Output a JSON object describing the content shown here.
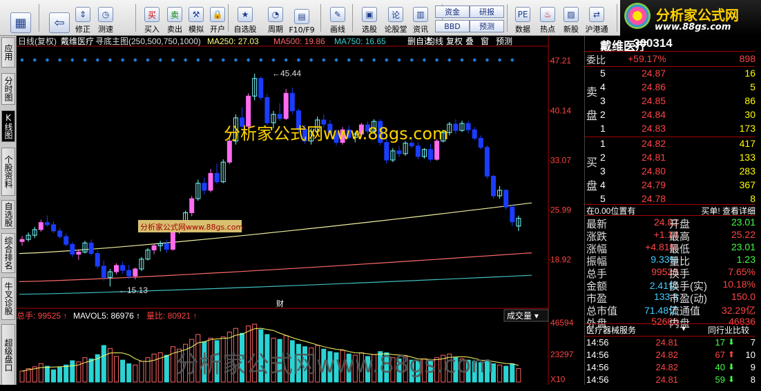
{
  "toolbar": {
    "buttons": [
      {
        "label": "",
        "icon": "grid-icon"
      },
      {
        "label": "",
        "icon": "back-arrow-icon"
      },
      {
        "label": "修正",
        "icon": "up-down-icon"
      },
      {
        "label": "测速",
        "icon": "clock-icon"
      },
      {
        "label": "买入",
        "icon": "buy-icon"
      },
      {
        "label": "卖出",
        "icon": "sell-icon"
      },
      {
        "label": "模拟",
        "icon": "hammer-icon"
      },
      {
        "label": "开户",
        "icon": "lock-icon"
      },
      {
        "label": "自选股",
        "icon": "star-icon"
      },
      {
        "label": "周期",
        "icon": "cycle-icon"
      },
      {
        "label": "F10/F9",
        "icon": "f10-icon"
      },
      {
        "label": "画线",
        "icon": "pen-icon"
      },
      {
        "label": "选股",
        "icon": "select-icon"
      },
      {
        "label": "论股堂",
        "icon": "forum-icon"
      },
      {
        "label": "资讯",
        "icon": "news-icon"
      },
      {
        "label": "数据",
        "icon": "pe-icon"
      },
      {
        "label": "热点",
        "icon": "fire-icon"
      },
      {
        "label": "新股",
        "icon": "new-icon"
      },
      {
        "label": "沪港通",
        "icon": "hk-icon"
      }
    ],
    "small": {
      "zijin": "资金",
      "bbd": "BBD",
      "yanbao": "研报",
      "yuce": "预测"
    },
    "buy_text": "买",
    "sell_text": "卖",
    "lun_text": "论"
  },
  "logo": {
    "title": "分析家公式网",
    "url": "www.88gs.com"
  },
  "sidetabs": [
    "应用",
    "分时图",
    "K线图",
    "个股资料",
    "自选股",
    "综合排名",
    "牛叉诊股",
    "超级盘口"
  ],
  "chart": {
    "period": "日线(复权)",
    "name": "戴维医疗",
    "indicator": "寻底主图(250,500,750,1000)",
    "ma250": "MA250: 27.03",
    "ma500": "MA500: 19.86",
    "ma750": "MA750: 16.65",
    "tools": [
      "删自选",
      "均线",
      "复权",
      "叠",
      "窗",
      "预测"
    ],
    "price_ticks": [
      "47.21",
      "40.14",
      "33.07",
      "25.99",
      "18.92"
    ],
    "max_label": "45.44",
    "min_label": "15.13",
    "watermark": "分析家公式网www.88gs.com",
    "badge": "分析家公式网www.88gs.com",
    "cai": "财",
    "vol_ticks": [
      "46594",
      "23297",
      "X10"
    ],
    "vol_header": {
      "zongshou": "总手: 99525",
      "mavol5": "MAVOL5: 86976",
      "liangbi": "量比: 80921"
    },
    "vol_dropdown": "成交量",
    "vol_watermark": "分析家公式网www.88gs.com"
  },
  "chart_data": {
    "type": "candlestick",
    "ylim": [
      12.5,
      49.0
    ],
    "candles": [
      [
        21.5,
        22.3,
        20.9,
        21.8
      ],
      [
        21.8,
        22.8,
        21.5,
        22.4
      ],
      [
        22.4,
        23.6,
        22.0,
        23.2
      ],
      [
        23.2,
        24.6,
        22.9,
        24.2
      ],
      [
        24.2,
        25.2,
        23.6,
        23.9
      ],
      [
        23.9,
        24.4,
        22.7,
        23.0
      ],
      [
        23.0,
        23.4,
        21.9,
        22.2
      ],
      [
        22.2,
        22.6,
        20.8,
        21.1
      ],
      [
        21.1,
        21.4,
        19.3,
        19.7
      ],
      [
        19.7,
        20.4,
        18.9,
        20.0
      ],
      [
        20.0,
        21.6,
        19.8,
        21.3
      ],
      [
        21.3,
        21.8,
        19.5,
        19.8
      ],
      [
        19.8,
        20.2,
        17.6,
        18.0
      ],
      [
        18.0,
        18.8,
        15.9,
        16.4
      ],
      [
        16.4,
        17.6,
        15.1,
        17.2
      ],
      [
        17.2,
        18.4,
        16.8,
        18.1
      ],
      [
        18.1,
        18.6,
        16.9,
        17.4
      ],
      [
        17.4,
        18.2,
        16.2,
        16.6
      ],
      [
        16.6,
        17.8,
        16.1,
        17.6
      ],
      [
        17.6,
        19.3,
        17.3,
        19.0
      ],
      [
        19.0,
        20.6,
        18.8,
        20.3
      ],
      [
        20.3,
        21.2,
        19.7,
        20.9
      ],
      [
        20.9,
        21.6,
        20.1,
        21.2
      ],
      [
        21.2,
        21.8,
        19.9,
        20.4
      ],
      [
        20.4,
        23.3,
        20.2,
        23.0
      ],
      [
        23.0,
        24.1,
        22.6,
        23.6
      ],
      [
        23.6,
        25.9,
        23.4,
        25.6
      ],
      [
        25.6,
        28.0,
        25.1,
        27.6
      ],
      [
        27.6,
        30.3,
        27.3,
        29.8
      ],
      [
        29.8,
        30.6,
        28.2,
        28.8
      ],
      [
        28.8,
        31.8,
        28.5,
        31.2
      ],
      [
        31.2,
        32.6,
        29.7,
        30.0
      ],
      [
        30.0,
        33.2,
        29.8,
        32.8
      ],
      [
        32.8,
        36.3,
        32.5,
        35.8
      ],
      [
        35.8,
        39.6,
        35.3,
        39.1
      ],
      [
        39.1,
        40.6,
        37.4,
        37.9
      ],
      [
        37.9,
        42.6,
        37.6,
        42.2
      ],
      [
        42.2,
        45.4,
        41.6,
        44.7
      ],
      [
        44.7,
        45.0,
        41.6,
        42.0
      ],
      [
        42.0,
        42.5,
        38.0,
        38.4
      ],
      [
        38.4,
        40.1,
        37.6,
        39.6
      ],
      [
        39.6,
        41.2,
        38.7,
        39.0
      ],
      [
        39.0,
        43.2,
        38.8,
        42.6
      ],
      [
        42.6,
        43.4,
        39.6,
        40.1
      ],
      [
        40.1,
        40.4,
        37.1,
        37.5
      ],
      [
        37.5,
        38.1,
        35.4,
        35.8
      ],
      [
        35.8,
        37.6,
        35.3,
        37.2
      ],
      [
        37.2,
        39.3,
        36.9,
        38.8
      ],
      [
        38.8,
        39.6,
        37.7,
        38.2
      ],
      [
        38.2,
        38.8,
        36.6,
        37.0
      ],
      [
        37.0,
        37.5,
        35.2,
        35.6
      ],
      [
        35.6,
        37.8,
        35.3,
        37.4
      ],
      [
        37.4,
        38.0,
        36.0,
        36.3
      ],
      [
        36.3,
        37.1,
        35.6,
        36.8
      ],
      [
        36.8,
        38.4,
        36.4,
        38.1
      ],
      [
        38.1,
        38.6,
        36.8,
        37.2
      ],
      [
        37.2,
        38.9,
        37.0,
        38.6
      ],
      [
        38.6,
        38.9,
        35.2,
        35.6
      ],
      [
        35.6,
        36.2,
        32.6,
        33.1
      ],
      [
        33.1,
        34.8,
        32.8,
        34.4
      ],
      [
        34.4,
        35.1,
        33.5,
        34.0
      ],
      [
        34.0,
        35.8,
        33.7,
        35.5
      ],
      [
        35.5,
        36.4,
        34.8,
        35.1
      ],
      [
        35.1,
        35.6,
        33.2,
        33.6
      ],
      [
        33.6,
        34.8,
        33.3,
        34.6
      ],
      [
        34.6,
        35.4,
        32.9,
        33.2
      ],
      [
        33.2,
        36.1,
        33.0,
        35.8
      ],
      [
        35.8,
        37.4,
        35.6,
        37.0
      ],
      [
        37.0,
        38.5,
        36.6,
        38.2
      ],
      [
        38.2,
        38.9,
        36.8,
        37.3
      ],
      [
        37.3,
        38.7,
        37.1,
        38.3
      ],
      [
        38.3,
        38.7,
        36.9,
        37.4
      ],
      [
        37.4,
        37.8,
        35.9,
        36.2
      ],
      [
        36.2,
        36.6,
        34.6,
        34.9
      ],
      [
        34.9,
        35.2,
        30.4,
        30.8
      ],
      [
        30.8,
        31.0,
        27.6,
        28.0
      ],
      [
        28.0,
        29.4,
        27.6,
        28.8
      ],
      [
        28.8,
        28.9,
        26.0,
        26.4
      ],
      [
        26.4,
        26.8,
        23.7,
        24.3
      ],
      [
        23.7,
        25.2,
        23.0,
        24.8
      ]
    ],
    "ma_lines": [
      {
        "name": "MA250",
        "color": "#f0f0a0",
        "from": 19.8,
        "to": 27.0
      },
      {
        "name": "MA500",
        "color": "#ff6a6a",
        "from": 15.8,
        "to": 19.9
      },
      {
        "name": "MA750",
        "color": "#40c0c0",
        "from": 14.0,
        "to": 16.7
      }
    ],
    "volume_max": 46594
  },
  "quote": {
    "name": "戴维医疗",
    "code": "300314",
    "weibi_label": "委比",
    "weibi": "+59.17%",
    "weibi_num": "898",
    "sell_label": "卖盘",
    "buy_label": "买盘",
    "asks": [
      [
        "5",
        "24.87",
        "16"
      ],
      [
        "4",
        "24.86",
        "5"
      ],
      [
        "3",
        "24.85",
        "86"
      ],
      [
        "2",
        "24.84",
        "30"
      ],
      [
        "1",
        "24.83",
        "173"
      ]
    ],
    "bids": [
      [
        "1",
        "24.82",
        "417"
      ],
      [
        "2",
        "24.81",
        "133"
      ],
      [
        "3",
        "24.80",
        "283"
      ],
      [
        "4",
        "24.79",
        "367"
      ],
      [
        "5",
        "24.78",
        "8"
      ]
    ],
    "position": "在0.00位置有",
    "position_right": "买单! 查看详细",
    "stats": [
      [
        "最新",
        "24.82",
        "开盘",
        "23.01"
      ],
      [
        "涨跌",
        "+1.14",
        "最高",
        "25.22"
      ],
      [
        "涨幅",
        "+4.81%",
        "最低",
        "23.01"
      ],
      [
        "振幅",
        "9.33%",
        "量比",
        "1.23"
      ],
      [
        "总手",
        "99525",
        "换手",
        "7.65%"
      ],
      [
        "金额",
        "2.41亿",
        "换手(实)",
        "10.18%"
      ],
      [
        "市盈",
        "133.3",
        "市盈(动)",
        "150.0"
      ],
      [
        "总市值",
        "71.48亿",
        "流通值",
        "32.29亿"
      ],
      [
        "外盘",
        "52688",
        "内盘",
        "46836"
      ]
    ],
    "industry": "医疗器械服务",
    "industry_compare": "同行业比较",
    "ticks": [
      [
        "14:56",
        "24.81",
        "17",
        "down",
        "7"
      ],
      [
        "14:56",
        "24.82",
        "67",
        "up",
        "10"
      ],
      [
        "14:56",
        "24.82",
        "40",
        "down",
        "9"
      ],
      [
        "14:56",
        "24.81",
        "59",
        "down",
        "8"
      ]
    ]
  }
}
